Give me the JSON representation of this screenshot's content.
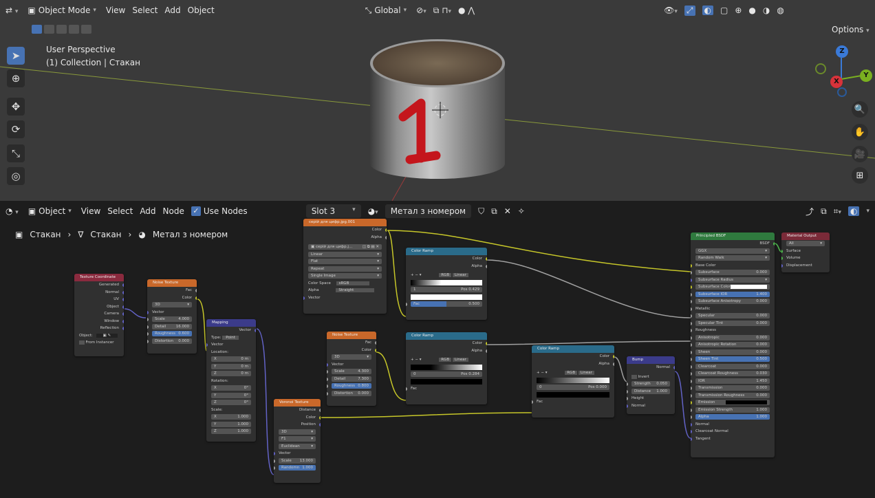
{
  "viewport": {
    "header": {
      "mode": "Object Mode",
      "menus": [
        "View",
        "Select",
        "Add",
        "Object"
      ],
      "orientation": "Global",
      "options": "Options"
    },
    "overlay": {
      "perspective": "User Perspective",
      "collection": "(1) Collection | Стакан"
    },
    "gizmo": {
      "z": "Z",
      "y": "Y",
      "x": "X"
    }
  },
  "node_editor": {
    "header": {
      "mode": "Object",
      "menus": [
        "View",
        "Select",
        "Add",
        "Node"
      ],
      "use_nodes": "Use Nodes",
      "slot": "Slot 3",
      "material": "Метал з номером"
    },
    "breadcrumb": [
      "Стакан",
      "Стакан",
      "Метал з номером"
    ]
  },
  "nodes": {
    "texcoord": {
      "title": "Texture Coordinate",
      "outputs": [
        "Generated",
        "Normal",
        "UV",
        "Object",
        "Camera",
        "Window",
        "Reflection"
      ],
      "object": "Object:",
      "instancer": "From Instancer"
    },
    "noise1": {
      "title": "Noise Texture",
      "outputs": [
        "Fac",
        "Color"
      ],
      "dim": "3D",
      "vector": "Vector",
      "fields": [
        [
          "Scale",
          "4.000"
        ],
        [
          "Detail",
          "16.000"
        ],
        [
          "Roughness",
          "0.600"
        ],
        [
          "Distortion",
          "0.000"
        ]
      ]
    },
    "mapping": {
      "title": "Mapping",
      "out": "Vector",
      "type_label": "Type:",
      "type": "Point",
      "vector": "Vector",
      "location": "Location:",
      "loc": [
        [
          "X",
          "0 m"
        ],
        [
          "Y",
          "0 m"
        ],
        [
          "Z",
          "0 m"
        ]
      ],
      "rotation": "Rotation:",
      "rot": [
        [
          "X",
          "0°"
        ],
        [
          "Y",
          "0°"
        ],
        [
          "Z",
          "0°"
        ]
      ],
      "scale": "Scale:",
      "scl": [
        [
          "X",
          "1.000"
        ],
        [
          "Y",
          "1.000"
        ],
        [
          "Z",
          "1.000"
        ]
      ]
    },
    "image": {
      "title": "серій для цифр.jpg.001",
      "outputs": [
        "Color",
        "Alpha"
      ],
      "file": "серій для цифр.j...",
      "opts": [
        "Linear",
        "Flat",
        "Repeat",
        "Single Image"
      ],
      "cs_label": "Color Space",
      "cs": "sRGB",
      "alpha_label": "Alpha",
      "alpha": "Straight",
      "vector": "Vector"
    },
    "ramp1": {
      "title": "Color Ramp",
      "outputs": [
        "Color",
        "Alpha"
      ],
      "mode": "RGB",
      "interp": "Linear",
      "idx": "1",
      "pos_label": "Pos",
      "pos": "0.429",
      "fac_label": "Fac",
      "fac": "0.500"
    },
    "noise2": {
      "title": "Noise Texture",
      "outputs": [
        "Fac",
        "Color"
      ],
      "dim": "3D",
      "vector": "Vector",
      "fields": [
        [
          "Scale",
          "4.300"
        ],
        [
          "Detail",
          "7.300"
        ],
        [
          "Roughness",
          "0.800"
        ],
        [
          "Distortion",
          "0.000"
        ]
      ]
    },
    "ramp2": {
      "title": "Color Ramp",
      "outputs": [
        "Color",
        "Alpha"
      ],
      "mode": "RGB",
      "interp": "Linear",
      "idx": "0",
      "pos_label": "Pos",
      "pos": "0.284",
      "fac": "Fac"
    },
    "voronoi": {
      "title": "Voronoi Texture",
      "outputs": [
        "Distance",
        "Color",
        "Position"
      ],
      "dim": "3D",
      "feature": "F1",
      "metric": "Euclidean",
      "vector": "Vector",
      "fields": [
        [
          "Scale",
          "13.000"
        ],
        [
          "Randomn",
          "1.000"
        ]
      ]
    },
    "ramp3": {
      "title": "Color Ramp",
      "outputs": [
        "Color",
        "Alpha"
      ],
      "mode": "RGB",
      "interp": "Linear",
      "idx": "0",
      "pos_label": "Pos",
      "pos": "0.000",
      "fac": "Fac"
    },
    "bump": {
      "title": "Bump",
      "out": "Normal",
      "invert": "Invert",
      "fields": [
        [
          "Strength",
          "0.050"
        ],
        [
          "Distance",
          "1.000"
        ]
      ],
      "inputs": [
        "Height",
        "Normal"
      ]
    },
    "bsdf": {
      "title": "Principled BSDF",
      "out": "BSDF",
      "dist": "GGX",
      "sss": "Random Walk",
      "rows": [
        [
          "Base Color",
          ""
        ],
        [
          "Subsurface",
          "0.000"
        ],
        [
          "Subsurface Radius",
          ""
        ],
        [
          "Subsurface Color",
          ""
        ],
        [
          "Subsurface IOR",
          "1.400"
        ],
        [
          "Subsurface Anisotropy",
          "0.000"
        ],
        [
          "Metallic",
          ""
        ],
        [
          "Specular",
          "0.000"
        ],
        [
          "Specular Tint",
          "0.000"
        ],
        [
          "Roughness",
          ""
        ],
        [
          "Anisotropic",
          "0.000"
        ],
        [
          "Anisotropic Rotation",
          "0.000"
        ],
        [
          "Sheen",
          "0.000"
        ],
        [
          "Sheen Tint",
          "0.500"
        ],
        [
          "Clearcoat",
          "0.000"
        ],
        [
          "Clearcoat Roughness",
          "0.030"
        ],
        [
          "IOR",
          "1.450"
        ],
        [
          "Transmission",
          "0.000"
        ],
        [
          "Transmission Roughness",
          "0.000"
        ],
        [
          "Emission",
          ""
        ],
        [
          "Emission Strength",
          "1.000"
        ],
        [
          "Alpha",
          "1.000"
        ],
        [
          "Normal",
          ""
        ],
        [
          "Clearcoat Normal",
          ""
        ],
        [
          "Tangent",
          ""
        ]
      ]
    },
    "output": {
      "title": "Material Output",
      "target": "All",
      "inputs": [
        "Surface",
        "Volume",
        "Displacement"
      ]
    }
  },
  "colors": {
    "accent": "#4772b3",
    "socket_color": "#c7c729",
    "socket_vector": "#6363c7",
    "socket_float": "#a1a1a1",
    "header_texture": "#c9682a",
    "header_converter": "#2a6b8a",
    "header_vector": "#3b3b8a",
    "header_input": "#8a2a3e",
    "header_shader": "#2f7a3e",
    "header_output": "#7a2a38"
  }
}
